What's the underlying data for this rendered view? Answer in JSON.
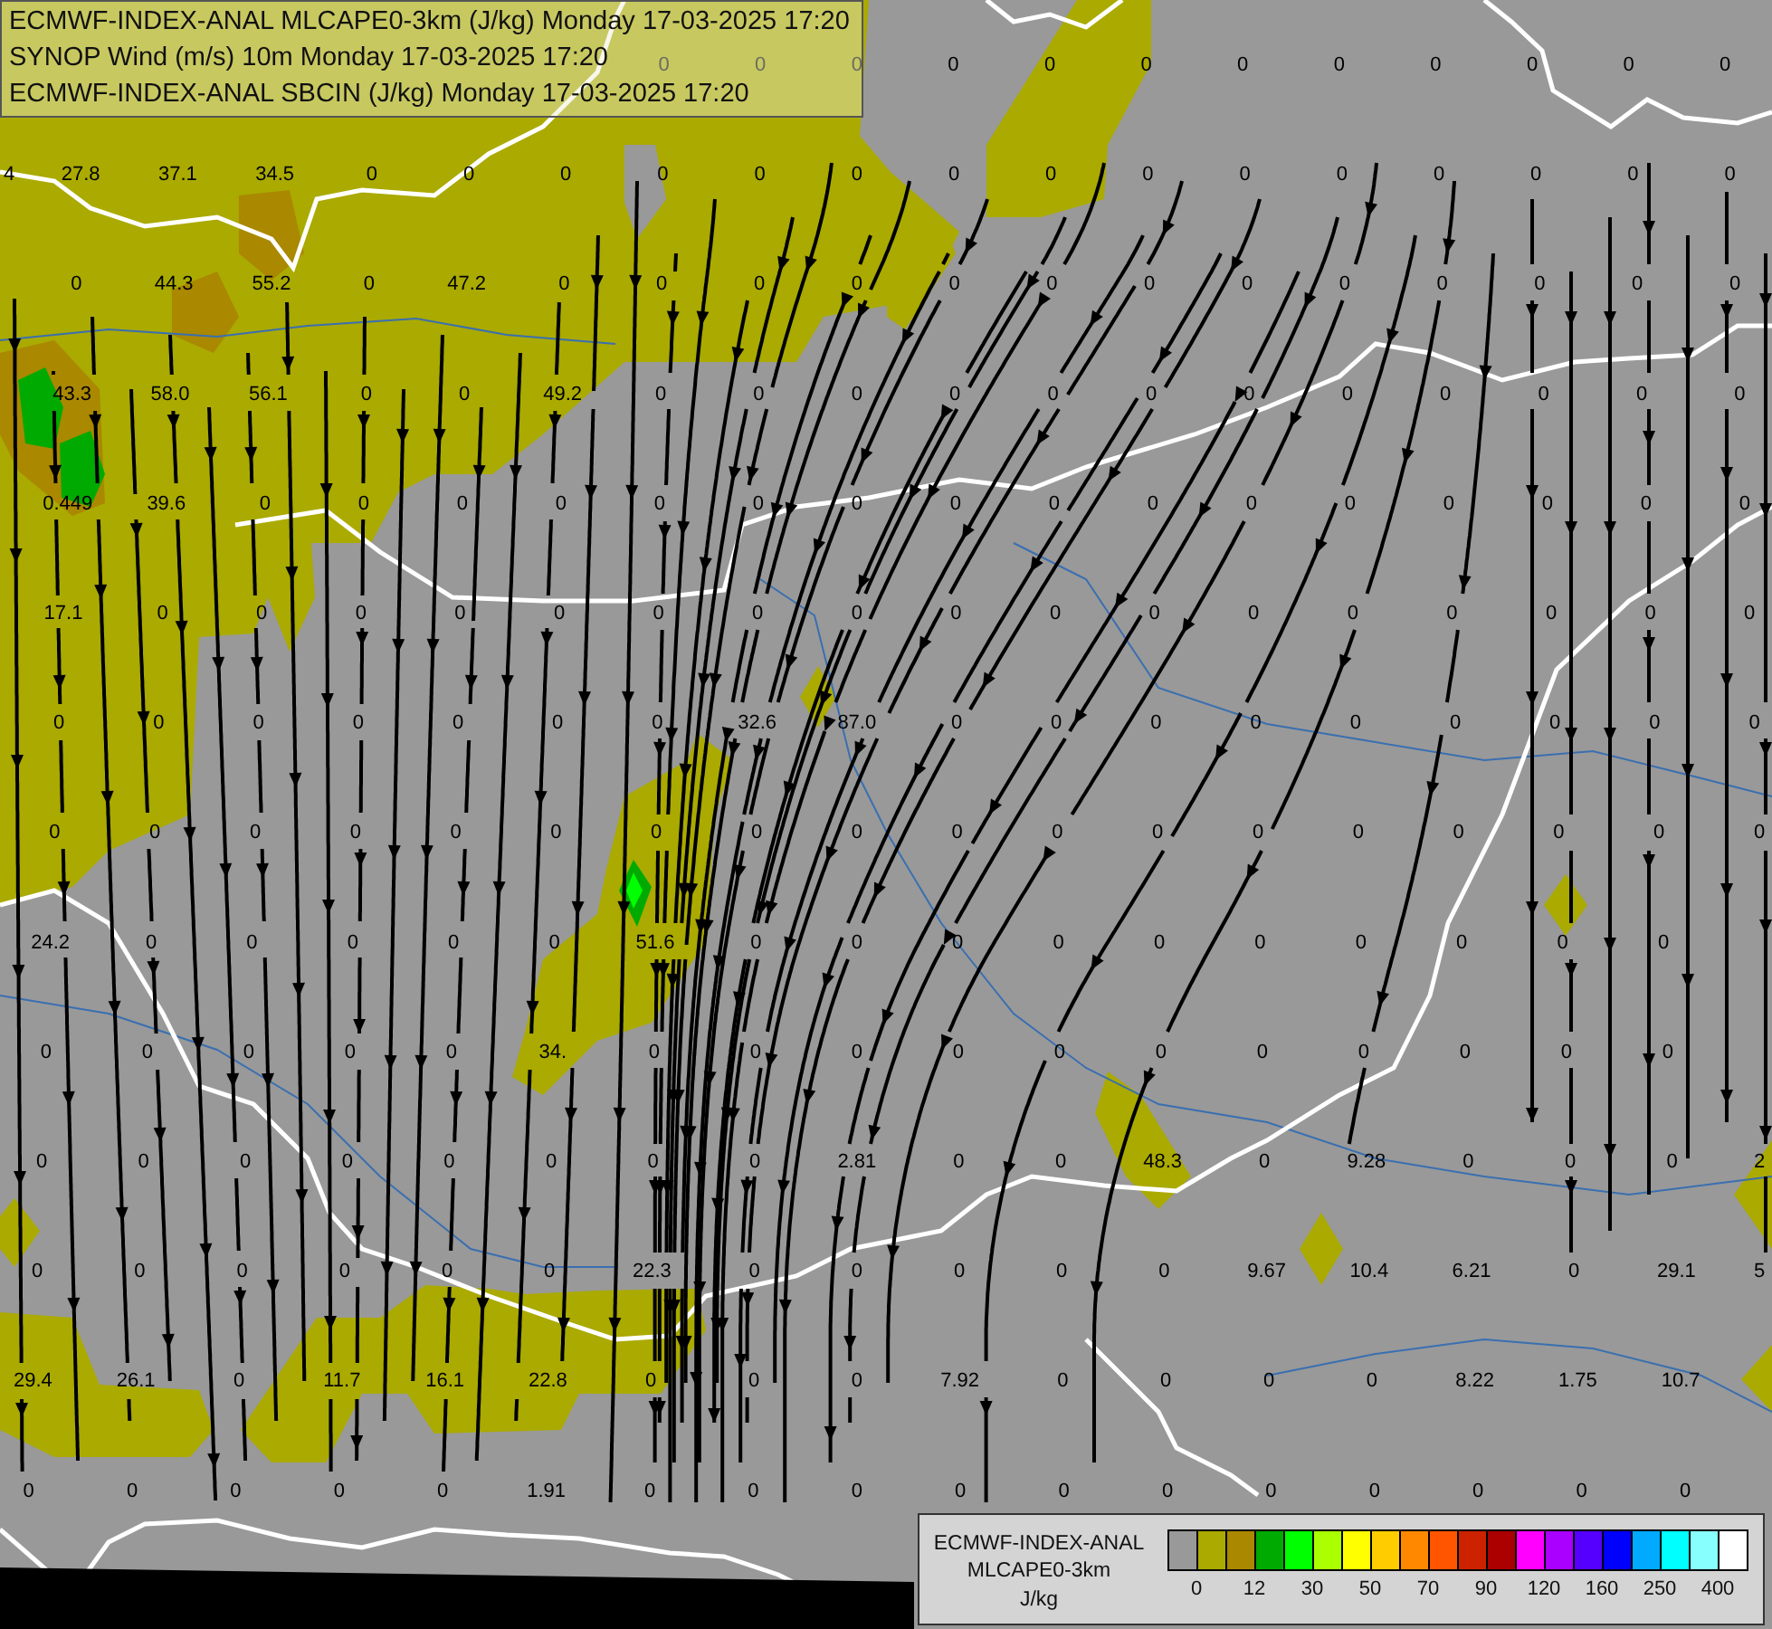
{
  "header": {
    "lines": [
      "ECMWF-INDEX-ANAL MLCAPE0-3km (J/kg) Monday 17-03-2025 17:20",
      "SYNOP Wind (m/s) 10m Monday 17-03-2025 17:20",
      "ECMWF-INDEX-ANAL SBCIN (J/kg) Monday 17-03-2025 17:20"
    ]
  },
  "map": {
    "value_rows": [
      [
        null,
        null,
        null,
        null,
        null,
        null,
        null,
        "0",
        "0",
        "0",
        "0",
        "0",
        "0",
        "0",
        "0",
        "0",
        "0",
        "0",
        "0"
      ],
      [
        "4",
        "27.8",
        "37.1",
        "34.5",
        "0",
        "0",
        "0",
        "0",
        "0",
        "0",
        "0",
        "0",
        "0",
        "0",
        "0",
        "0",
        "0",
        "0",
        "0"
      ],
      [
        null,
        "0",
        "44.3",
        "55.2",
        "0",
        "47.2",
        "0",
        "0",
        "0",
        "0",
        "0",
        "0",
        "0",
        "0",
        "0",
        "0",
        "0",
        "0",
        "0"
      ],
      [
        null,
        "43.3",
        "58.0",
        "56.1",
        "0",
        "0",
        "49.2",
        "0",
        "0",
        "0",
        "0",
        "0",
        "0",
        "0",
        "0",
        "0",
        "0",
        "0",
        "0"
      ],
      [
        null,
        "0.449",
        "39.6",
        "0",
        "0",
        "0",
        "0",
        "0",
        "0",
        "0",
        "0",
        "0",
        "0",
        "0",
        "0",
        "0",
        "0",
        "0",
        "0"
      ],
      [
        null,
        "17.1",
        "0",
        "0",
        "0",
        "0",
        "0",
        "0",
        "0",
        "0",
        "0",
        "0",
        "0",
        "0",
        "0",
        "0",
        "0",
        "0",
        "0"
      ],
      [
        null,
        "0",
        "0",
        "0",
        "0",
        "0",
        "0",
        "0",
        "32.6",
        "87.0",
        "0",
        "0",
        "0",
        "0",
        "0",
        "0",
        "0",
        "0",
        "0"
      ],
      [
        null,
        "0",
        "0",
        "0",
        "0",
        "0",
        "0",
        "0",
        "0",
        "0",
        "0",
        "0",
        "0",
        "0",
        "0",
        "0",
        "0",
        "0",
        "0"
      ],
      [
        null,
        "24.2",
        "0",
        "0",
        "0",
        "0",
        "0",
        "51.6",
        "0",
        "0",
        "0",
        "0",
        "0",
        "0",
        "0",
        "0",
        "0",
        "0"
      ],
      [
        null,
        "0",
        "0",
        "0",
        "0",
        "0",
        "34.",
        "0",
        "0",
        "0",
        "0",
        "0",
        "0",
        "0",
        "0",
        "0",
        "0",
        "0"
      ],
      [
        null,
        "0",
        "0",
        "0",
        "0",
        "0",
        "0",
        "0",
        "0",
        "2.81",
        "0",
        "0",
        "48.3",
        "0",
        "9.28",
        "0",
        "0",
        "0",
        "2"
      ],
      [
        null,
        "0",
        "0",
        "0",
        "0",
        "0",
        "0",
        "22.3",
        "0",
        "0",
        "0",
        "0",
        "0",
        "9.67",
        "10.4",
        "6.21",
        "0",
        "29.1",
        "5"
      ],
      [
        null,
        "29.4",
        "26.1",
        "0",
        "11.7",
        "16.1",
        "22.8",
        "0",
        "0",
        "0",
        "7.92",
        "0",
        "0",
        "0",
        "0",
        "8.22",
        "1.75",
        "10.7"
      ],
      [
        null,
        "0",
        "0",
        "0",
        "0",
        "0",
        "1.91",
        "0",
        "0",
        "0",
        "0",
        "0",
        "0",
        "0",
        "0",
        "0",
        "0",
        "0"
      ]
    ]
  },
  "legend": {
    "title_lines": [
      "ECMWF-INDEX-ANAL",
      "MLCAPE0-3km"
    ],
    "unit": "J/kg",
    "swatches": [
      {
        "color": "#999999"
      },
      {
        "color": "#aaaa00"
      },
      {
        "color": "#aa8800"
      },
      {
        "color": "#00aa00"
      },
      {
        "color": "#00ff00"
      },
      {
        "color": "#aaff00"
      },
      {
        "color": "#ffff00"
      },
      {
        "color": "#ffcc00"
      },
      {
        "color": "#ff8800"
      },
      {
        "color": "#ff5500"
      },
      {
        "color": "#cc2200"
      },
      {
        "color": "#aa0000"
      },
      {
        "color": "#ff00ff"
      },
      {
        "color": "#aa00ff"
      },
      {
        "color": "#5500ff"
      },
      {
        "color": "#0000ff"
      },
      {
        "color": "#00aaff"
      },
      {
        "color": "#00ffff"
      },
      {
        "color": "#88ffff"
      },
      {
        "color": "#ffffff"
      }
    ],
    "tick_labels": [
      "0",
      "12",
      "30",
      "50",
      "70",
      "90",
      "120",
      "160",
      "250",
      "400"
    ]
  }
}
